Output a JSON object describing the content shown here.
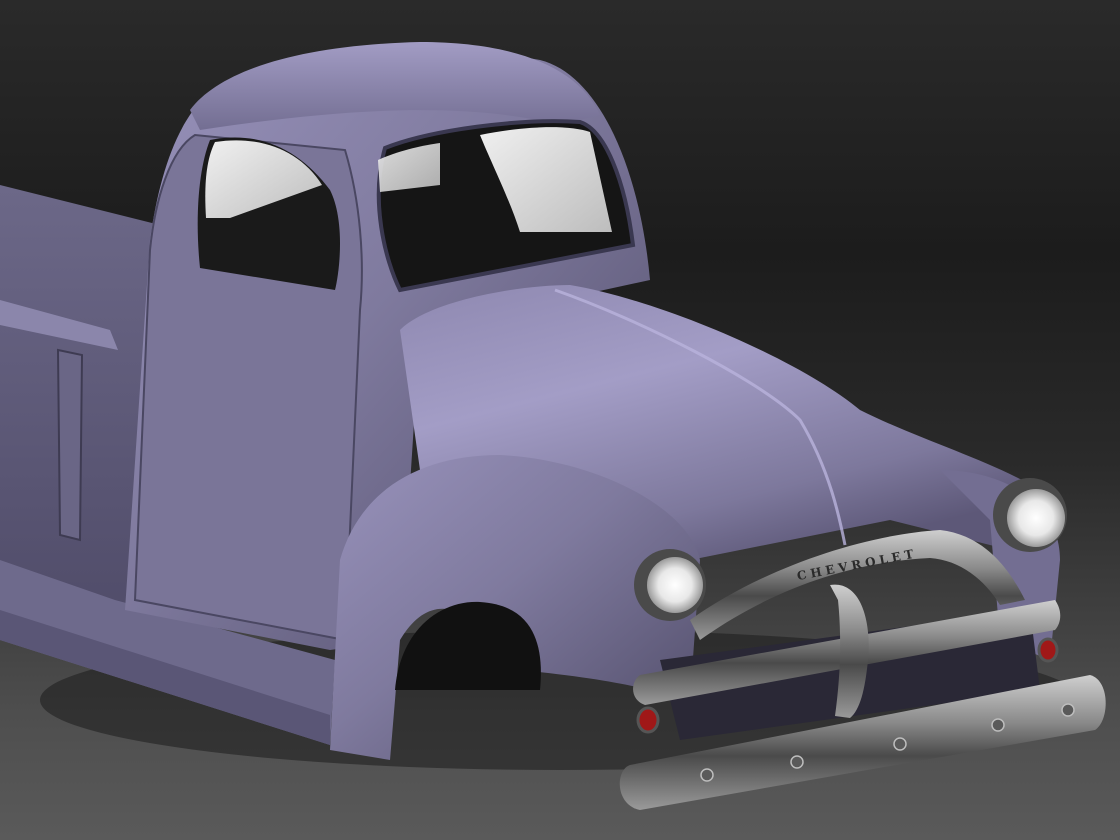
{
  "scene": {
    "grille_emblem_text": "CHEVROLET"
  },
  "colors": {
    "body_paint": "#7f7a9e",
    "body_shadow": "#4e4a66",
    "body_highlight": "#a9a3cc",
    "chrome": "#8f8f8f",
    "glass": "#d9d9d9",
    "background_top": "#1c1c1c",
    "background_floor": "#5a5a5a",
    "tail_light": "#a01818"
  }
}
